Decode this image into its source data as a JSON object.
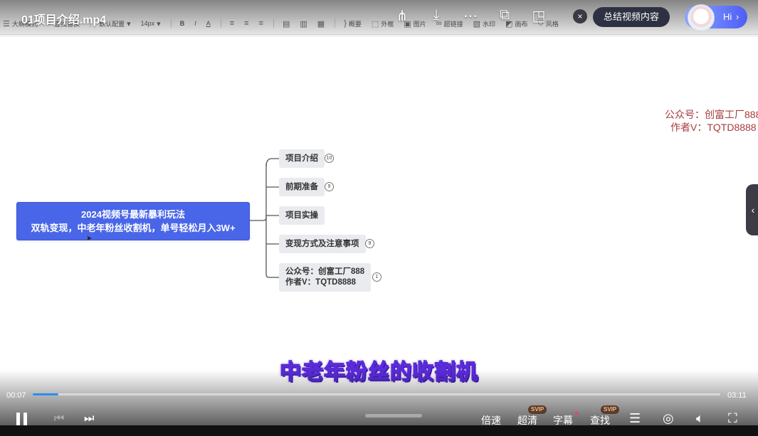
{
  "video": {
    "title": "01项目介绍.mp4",
    "current_time": "00:07",
    "duration": "03:11",
    "progress_fraction": 0.037,
    "subtitle": "中老年粉丝的收割机"
  },
  "toolbar": {
    "items": [
      "大纲模式",
      "查找替换",
      "默认配置",
      "14px",
      "B",
      "I",
      "A",
      "概要",
      "外框",
      "图片",
      "超链接",
      "水印",
      "画布",
      "风格"
    ]
  },
  "overlay": {
    "summary_button": "总结视频内容",
    "assistant_label": "Hi",
    "assistant_arrow": "›",
    "close_symbol": "×",
    "top_icons": [
      "share-icon",
      "download-icon",
      "more-icon",
      "picture-in-picture-icon",
      "mini-window-icon"
    ],
    "edge_tab_symbol": "‹"
  },
  "watermark": {
    "line1": "公众号：创富工厂888",
    "line2": "作者V：TQTD8888"
  },
  "mindmap": {
    "root_line1": "2024视频号最新暴利玩法",
    "root_line2": "双轨变现，中老年粉丝收割机，单号轻松月入3W+",
    "children": [
      {
        "label": "项目介绍",
        "badge": "10"
      },
      {
        "label": "前期准备",
        "badge": "9"
      },
      {
        "label": "项目实操",
        "badge": ""
      },
      {
        "label": "变现方式及注意事项",
        "badge": "9"
      },
      {
        "label_line1": "公众号：创富工厂888",
        "label_line2": "作者V：TQTD8888",
        "badge": "1"
      }
    ]
  },
  "controls": {
    "speed": "倍速",
    "quality": "超清",
    "quality_badge": "SVIP",
    "captions": "字幕",
    "search": "查找",
    "search_badge": "SVIP"
  },
  "colors": {
    "root_node": "#4a66e8",
    "child_node": "#e9ebee",
    "progress": "#2e8cf0",
    "watermark": "#a83c3c",
    "subtitle_stroke": "#5a2bd8"
  }
}
